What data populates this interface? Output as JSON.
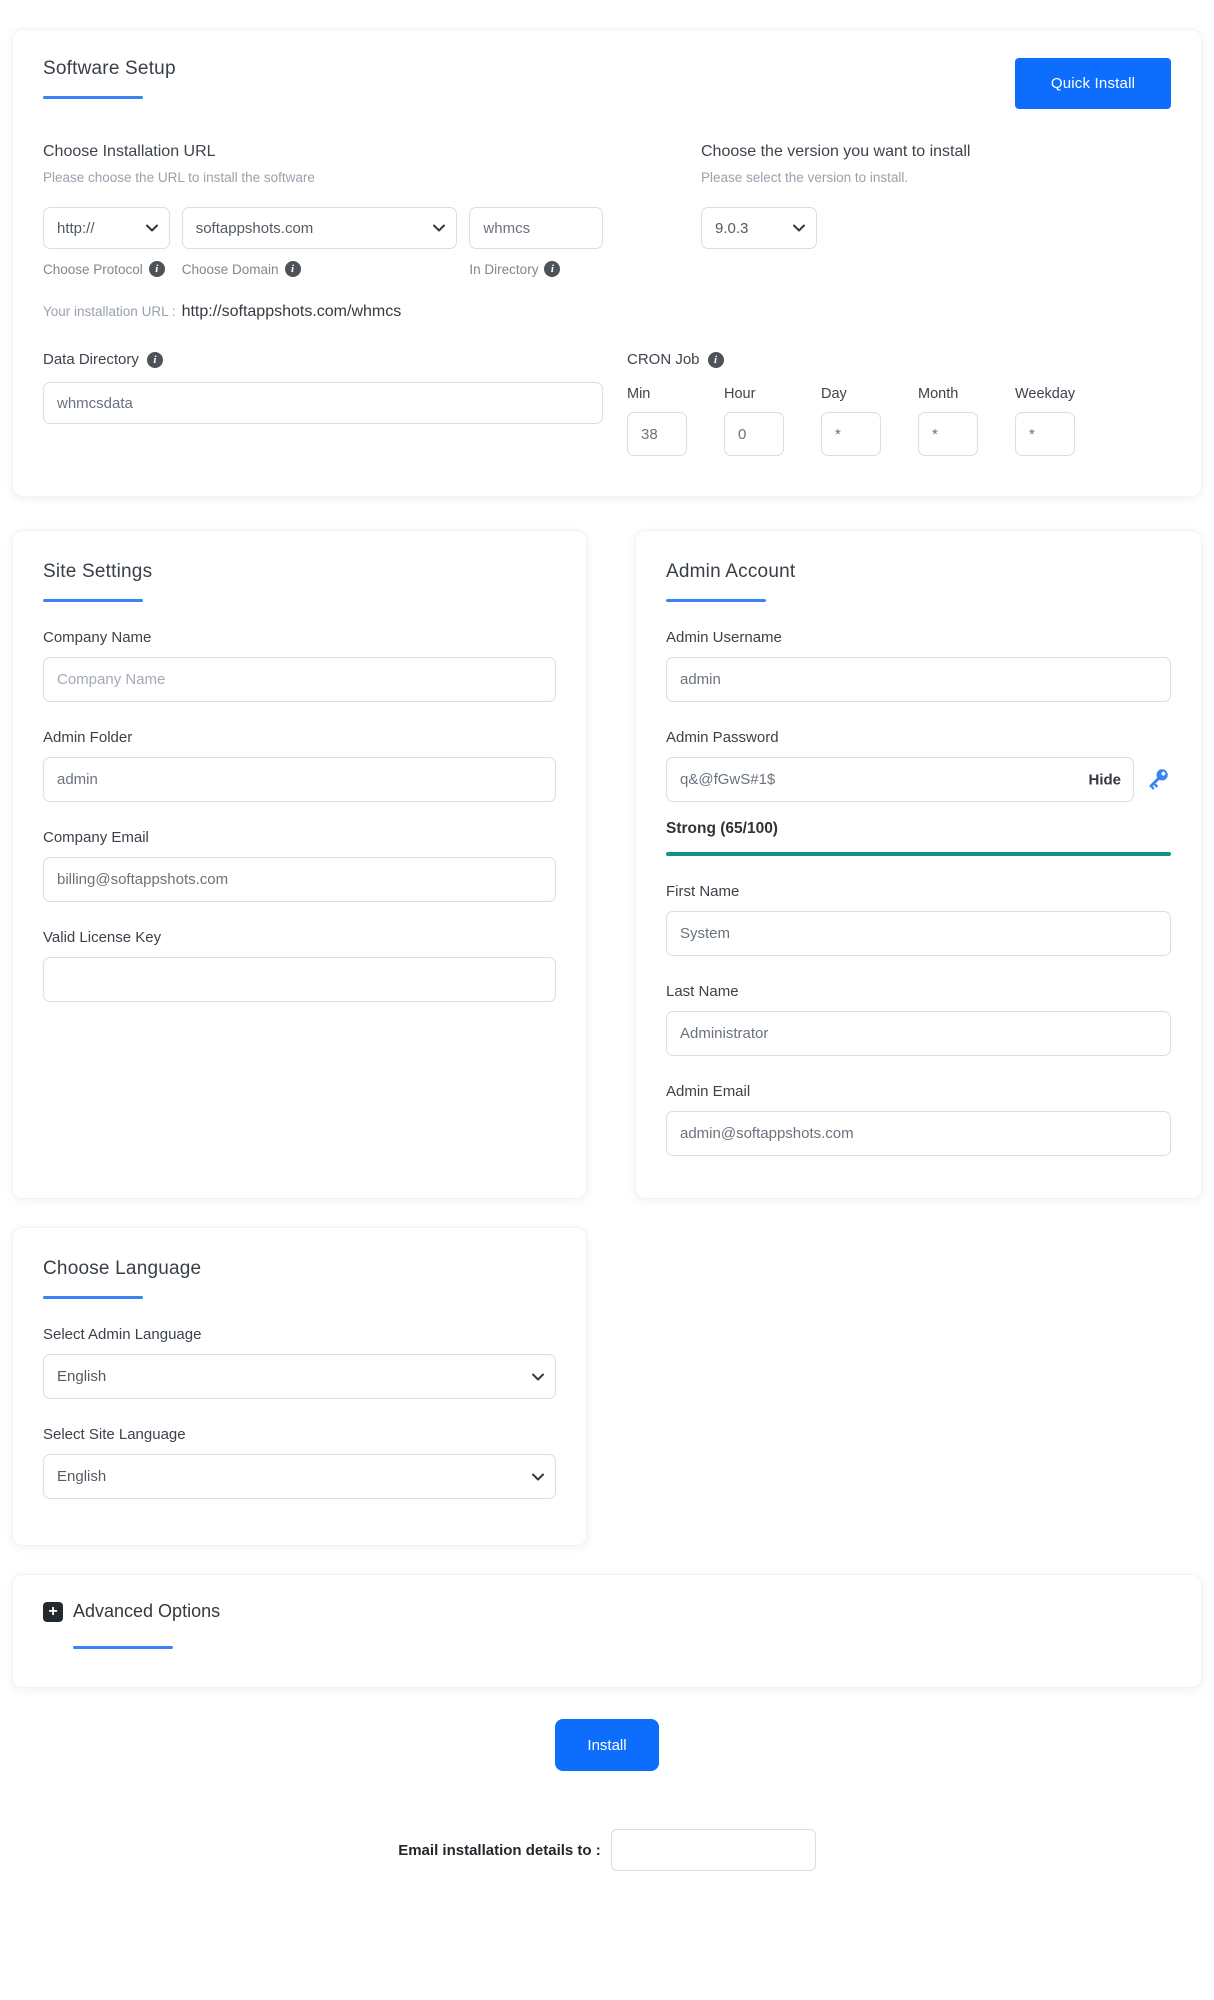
{
  "colors": {
    "accent_blue": "#3b82f6",
    "button_blue": "#0d6efd",
    "strength_teal": "#0d9488"
  },
  "software_setup": {
    "title": "Software Setup",
    "quick_install_label": "Quick Install",
    "installation_url": {
      "heading": "Choose Installation URL",
      "subheading": "Please choose the URL to install the software",
      "protocol_value": "http://",
      "protocol_label": "Choose Protocol",
      "domain_value": "softappshots.com",
      "domain_label": "Choose Domain",
      "directory_value": "whmcs",
      "directory_label": "In Directory",
      "result_label": "Your installation URL :",
      "result_value": "http://softappshots.com/whmcs"
    },
    "version": {
      "heading": "Choose the version you want to install",
      "subheading": "Please select the version to install.",
      "value": "9.0.3"
    },
    "data_directory": {
      "label": "Data Directory",
      "value": "whmcsdata"
    },
    "cron": {
      "label": "CRON Job",
      "fields": [
        {
          "label": "Min",
          "value": "38"
        },
        {
          "label": "Hour",
          "value": "0"
        },
        {
          "label": "Day",
          "value": "*"
        },
        {
          "label": "Month",
          "value": "*"
        },
        {
          "label": "Weekday",
          "value": "*"
        }
      ]
    }
  },
  "site_settings": {
    "title": "Site Settings",
    "company_name": {
      "label": "Company Name",
      "placeholder": "Company Name"
    },
    "admin_folder": {
      "label": "Admin Folder",
      "value": "admin"
    },
    "company_email": {
      "label": "Company Email",
      "value": "billing@softappshots.com"
    },
    "license_key": {
      "label": "Valid License Key",
      "value": ""
    }
  },
  "admin_account": {
    "title": "Admin Account",
    "username": {
      "label": "Admin Username",
      "value": "admin"
    },
    "password": {
      "label": "Admin Password",
      "value": "q&@fGwS#1$",
      "hide_label": "Hide"
    },
    "strength_text": "Strong (65/100)",
    "first_name": {
      "label": "First Name",
      "value": "System"
    },
    "last_name": {
      "label": "Last Name",
      "value": "Administrator"
    },
    "admin_email": {
      "label": "Admin Email",
      "value": "admin@softappshots.com"
    }
  },
  "choose_language": {
    "title": "Choose Language",
    "admin_language": {
      "label": "Select Admin Language",
      "value": "English"
    },
    "site_language": {
      "label": "Select Site Language",
      "value": "English"
    }
  },
  "advanced_options": {
    "title": "Advanced Options"
  },
  "footer": {
    "install_label": "Install",
    "email_label": "Email installation details to :"
  }
}
